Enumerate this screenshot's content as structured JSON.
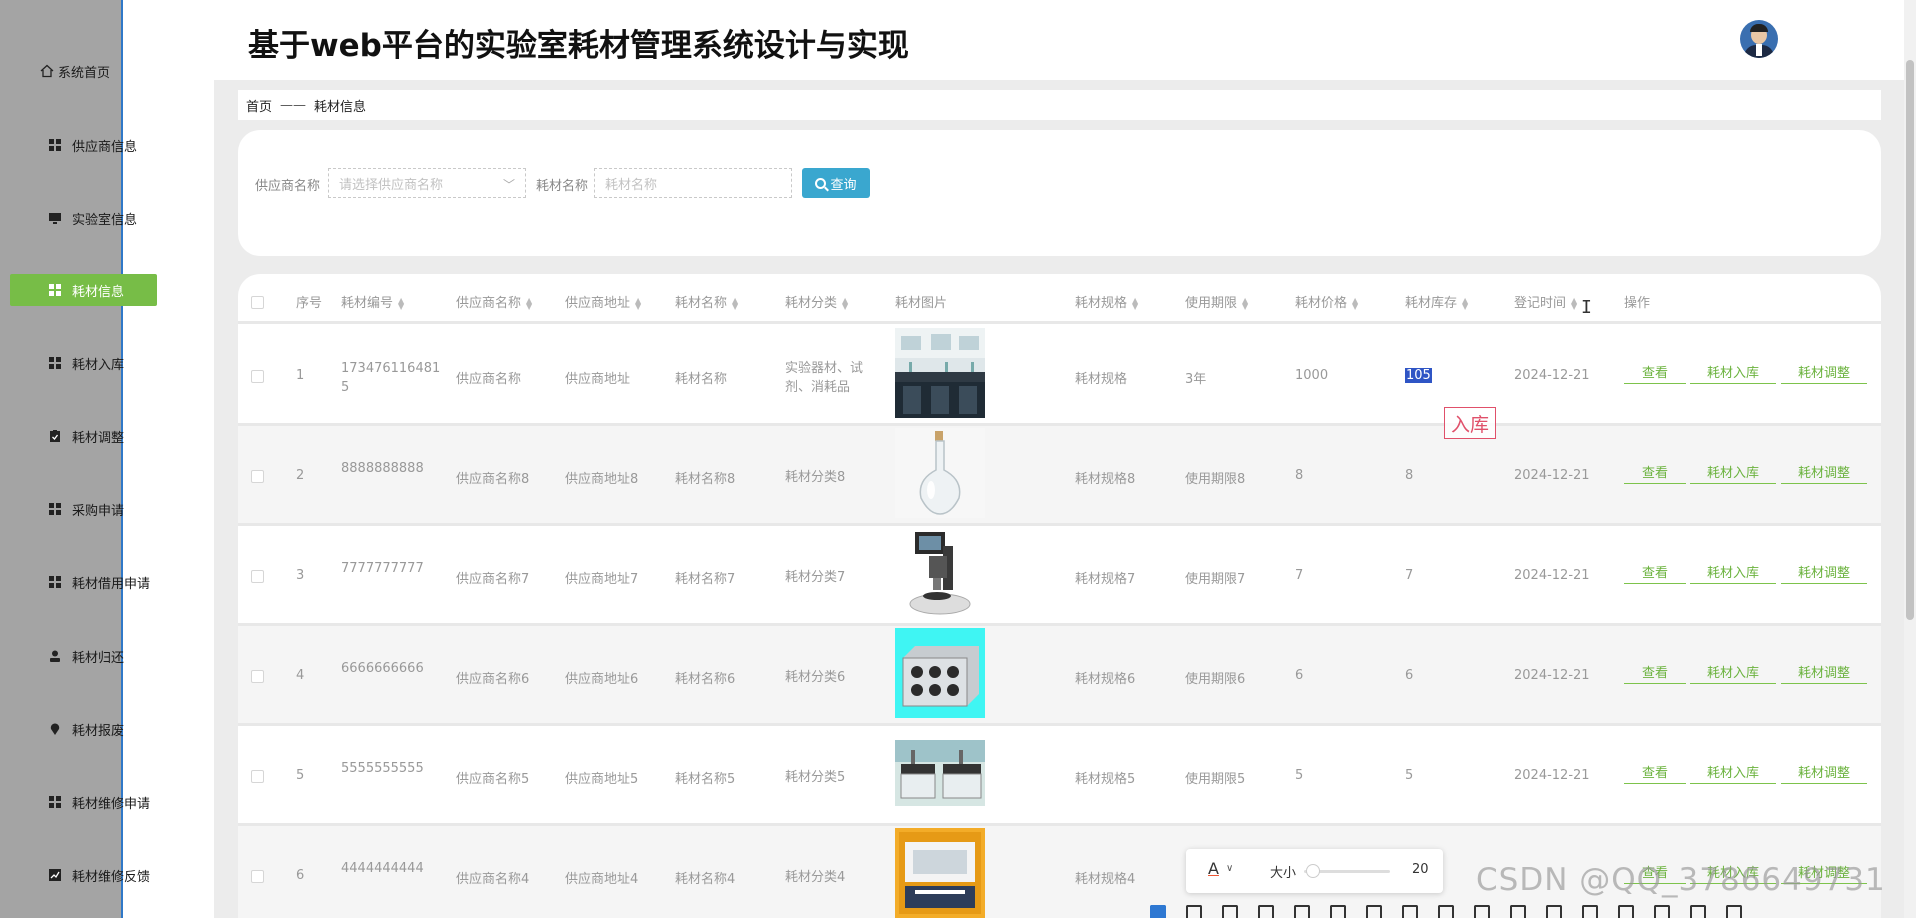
{
  "app_title": "基于web平台的实验室耗材管理系统设计与实现",
  "sidebar": {
    "items": [
      {
        "label": "系统首页",
        "icon": "home-icon"
      },
      {
        "label": "供应商信息",
        "icon": "grid-icon"
      },
      {
        "label": "实验室信息",
        "icon": "monitor-icon"
      },
      {
        "label": "耗材信息",
        "icon": "grid-icon",
        "active": true
      },
      {
        "label": "耗材入库",
        "icon": "grid-icon"
      },
      {
        "label": "耗材调整",
        "icon": "clipboard-icon"
      },
      {
        "label": "采购申请",
        "icon": "grid-icon"
      },
      {
        "label": "耗材借用申请",
        "icon": "grid-icon"
      },
      {
        "label": "耗材归还",
        "icon": "user-icon"
      },
      {
        "label": "耗材报废",
        "icon": "map-pin-icon"
      },
      {
        "label": "耗材维修申请",
        "icon": "grid-icon"
      },
      {
        "label": "耗材维修反馈",
        "icon": "chart-icon"
      }
    ]
  },
  "breadcrumb": {
    "home": "首页",
    "separator": "——",
    "current": "耗材信息"
  },
  "search": {
    "supplier_label": "供应商名称",
    "supplier_placeholder": "请选择供应商名称",
    "material_label": "耗材名称",
    "material_placeholder": "耗材名称",
    "button": "查询"
  },
  "table": {
    "headers": [
      "序号",
      "耗材编号",
      "供应商名称",
      "供应商地址",
      "耗材名称",
      "耗材分类",
      "耗材图片",
      "耗材规格",
      "使用期限",
      "耗材价格",
      "耗材库存",
      "登记时间",
      "操作"
    ],
    "actions": {
      "view": "查看",
      "stock_in": "耗材入库",
      "adjust": "耗材调整"
    },
    "rows": [
      {
        "no": "1",
        "code": "173476116481 5",
        "supplier": "供应商名称",
        "address": "供应商地址",
        "name": "耗材名称",
        "category": "实验器材、试剂、消耗品",
        "image": "lab-room",
        "spec": "耗材规格",
        "term": "3年",
        "price": "1000",
        "stock": "105",
        "time": "2024-12-21"
      },
      {
        "no": "2",
        "code": "8888888888",
        "supplier": "供应商名称8",
        "address": "供应商地址8",
        "name": "耗材名称8",
        "category": "耗材分类8",
        "image": "flask",
        "spec": "耗材规格8",
        "term": "使用期限8",
        "price": "8",
        "stock": "8",
        "time": "2024-12-21"
      },
      {
        "no": "3",
        "code": "7777777777",
        "supplier": "供应商名称7",
        "address": "供应商地址7",
        "name": "耗材名称7",
        "category": "耗材分类7",
        "image": "microscope",
        "spec": "耗材规格7",
        "term": "使用期限7",
        "price": "7",
        "stock": "7",
        "time": "2024-12-21"
      },
      {
        "no": "4",
        "code": "6666666666",
        "supplier": "供应商名称6",
        "address": "供应商地址6",
        "name": "耗材名称6",
        "category": "耗材分类6",
        "image": "resistance-box",
        "spec": "耗材规格6",
        "term": "使用期限6",
        "price": "6",
        "stock": "6",
        "time": "2024-12-21"
      },
      {
        "no": "5",
        "code": "5555555555",
        "supplier": "供应商名称5",
        "address": "供应商地址5",
        "name": "耗材名称5",
        "category": "耗材分类5",
        "image": "lab-benches",
        "spec": "耗材规格5",
        "term": "使用期限5",
        "price": "5",
        "stock": "5",
        "time": "2024-12-21"
      },
      {
        "no": "6",
        "code": "4444444444",
        "supplier": "供应商名称4",
        "address": "供应商地址4",
        "name": "耗材名称4",
        "category": "耗材分类4",
        "image": "instrument-box",
        "spec": "耗材规格4",
        "term": "",
        "price": "",
        "stock": "",
        "time": ""
      }
    ]
  },
  "annotation": {
    "stamp_text": "入库"
  },
  "float_toolbar": {
    "font_glyph": "A",
    "size_label": "大小",
    "size_value": "20"
  },
  "watermark": "CSDN @QQ_3786649731",
  "colors": {
    "accent_green": "#77bd47",
    "search_blue": "#3aa7cf",
    "sidebar_line": "#2f78c8",
    "highlight": "#2f55c5"
  }
}
